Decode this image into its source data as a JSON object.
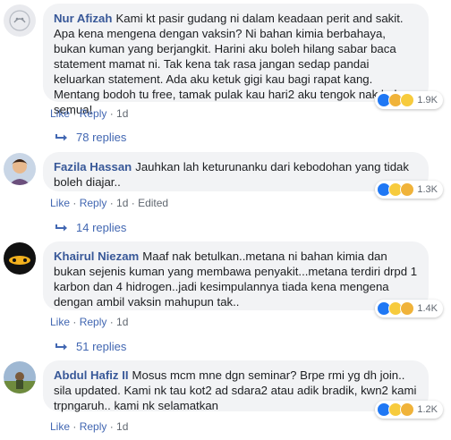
{
  "comments": [
    {
      "author": "Nur Afizah",
      "text": "Kami kt pasir gudang ni dalam keadaan perit and sakit. Apa kena mengena dengan vaksin? Ni bahan kimia berbahaya, bukan kuman yang berjangkit. Harini aku boleh hilang sabar baca statement mamat ni. Tak kena tak rasa jangan sedap pandai keluarkan statement. Ada aku ketuk gigi kau bagi rapat kang. Mentang bodoh tu free, tamak pulak kau hari2 aku tengok nak balun semua!",
      "like": "Like",
      "reply": "Reply",
      "time": "1d",
      "edited": "",
      "reaction_count": "1.9K",
      "replies": "78 replies"
    },
    {
      "author": "Fazila Hassan",
      "text": "Jauhkan lah keturunanku dari kebodohan yang tidak boleh diajar..",
      "like": "Like",
      "reply": "Reply",
      "time": "1d",
      "edited": "Edited",
      "reaction_count": "1.3K",
      "replies": "14 replies"
    },
    {
      "author": "Khairul Niezam",
      "text": "Maaf nak betulkan..metana ni bahan kimia dan bukan sejenis kuman yang membawa penyakit...metana terdiri drpd 1 karbon dan 4 hidrogen..jadi kesimpulannya tiada kena mengena dengan ambil vaksin mahupun tak..",
      "like": "Like",
      "reply": "Reply",
      "time": "1d",
      "edited": "",
      "reaction_count": "1.4K",
      "replies": "51 replies"
    },
    {
      "author": "Abdul Hafiz II",
      "text": "Mosus mcm mne dgn seminar? Brpe rmi yg dh join.. sila updated. Kami nk tau kot2 ad sdara2 atau adik bradik, kwn2 kami trpngaruh.. kami nk selamatkan",
      "like": "Like",
      "reply": "Reply",
      "time": "1d",
      "edited": "",
      "reaction_count": "1.2K",
      "replies": ""
    }
  ],
  "colors": {
    "author": "#385898",
    "link": "#4267b2",
    "bubble": "#f2f3f5",
    "meta": "#606770"
  }
}
